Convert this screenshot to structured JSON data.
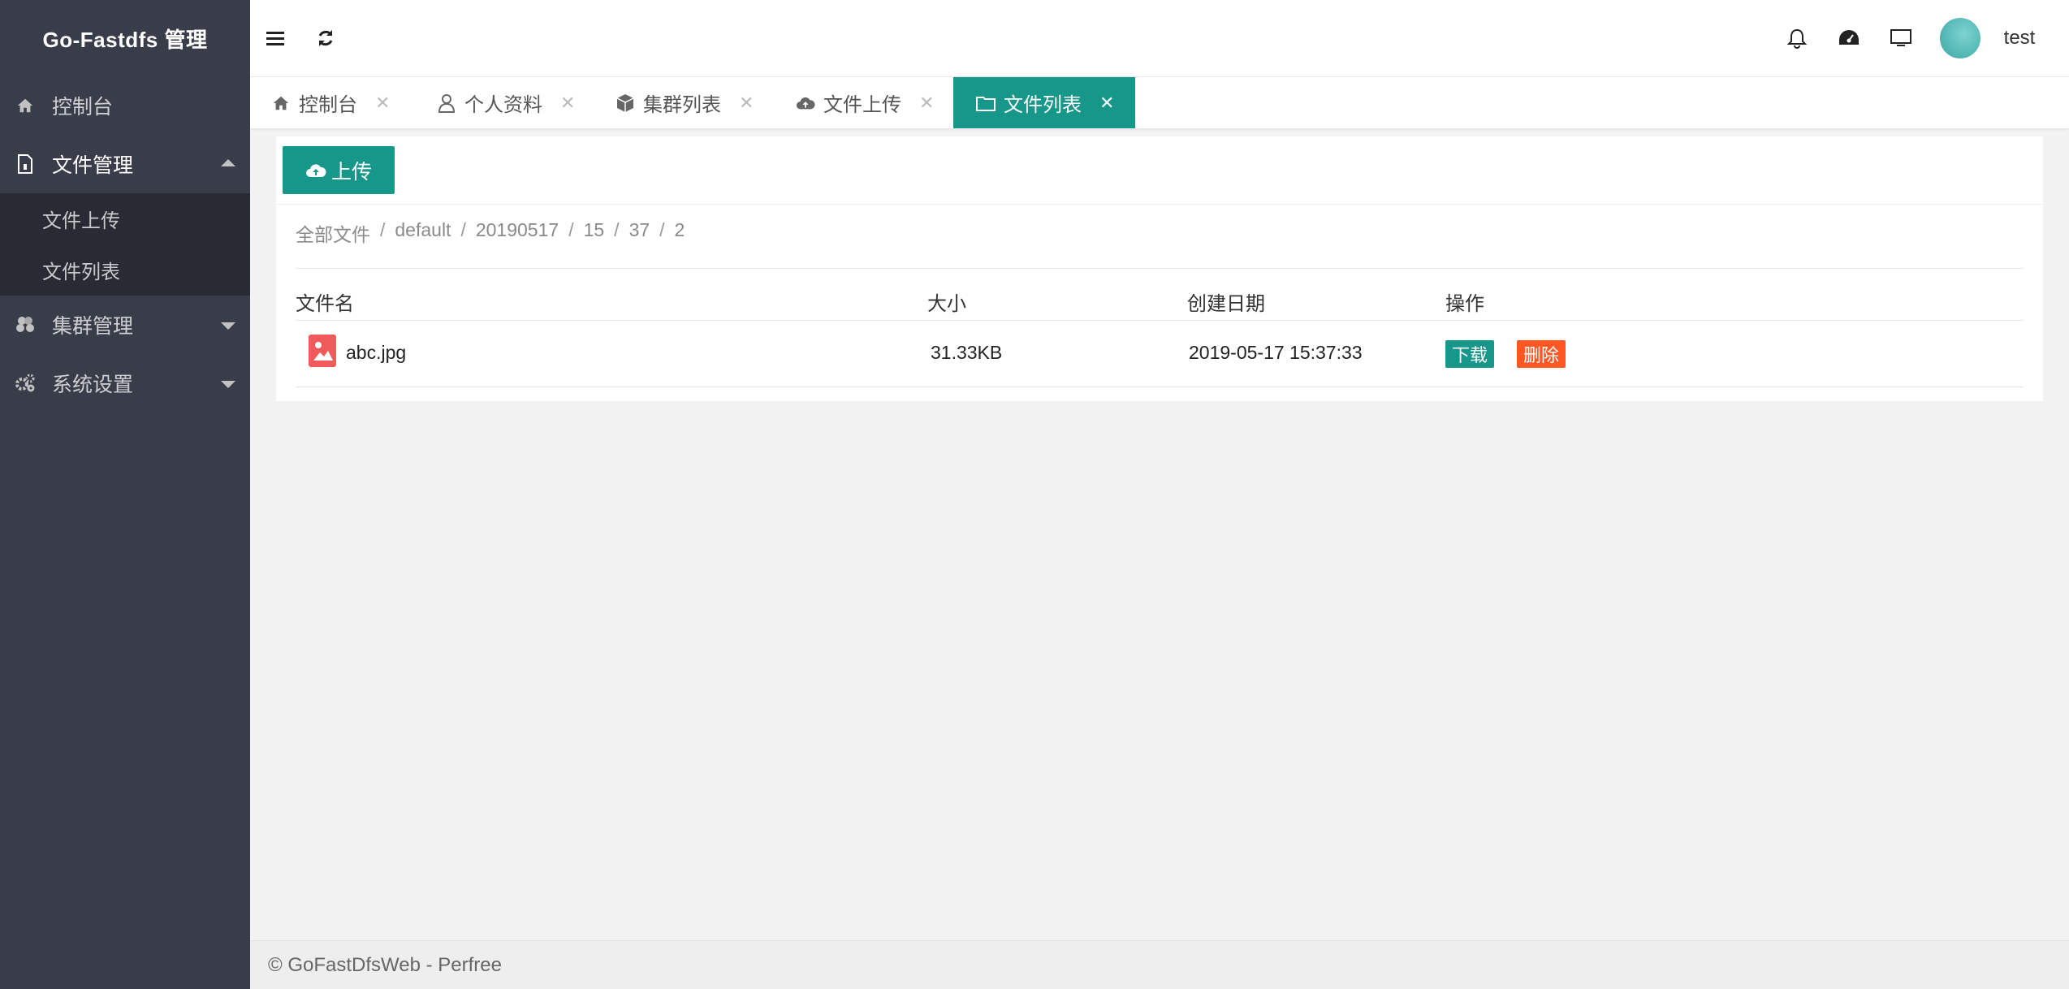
{
  "app": {
    "title": "Go-Fastdfs 管理"
  },
  "sidebar": {
    "items": [
      {
        "label": "控制台",
        "icon": "home-icon"
      },
      {
        "label": "文件管理",
        "icon": "file-icon",
        "expanded": true,
        "children": [
          {
            "label": "文件上传"
          },
          {
            "label": "文件列表"
          }
        ]
      },
      {
        "label": "集群管理",
        "icon": "cubes-icon"
      },
      {
        "label": "系统设置",
        "icon": "gears-icon"
      }
    ]
  },
  "header": {
    "menu_icon": "menu-icon",
    "refresh_icon": "refresh-icon",
    "right_icons": [
      "bell-icon",
      "dashboard-icon",
      "monitor-icon"
    ],
    "user": {
      "name": "test"
    }
  },
  "tabs": [
    {
      "label": "控制台",
      "icon": "home-icon",
      "active": false
    },
    {
      "label": "个人资料",
      "icon": "user-icon",
      "active": false
    },
    {
      "label": "集群列表",
      "icon": "cube-icon",
      "active": false
    },
    {
      "label": "文件上传",
      "icon": "cloud-upload-icon",
      "active": false
    },
    {
      "label": "文件列表",
      "icon": "folder-icon",
      "active": true
    }
  ],
  "content": {
    "upload_button": "上传",
    "breadcrumb": [
      "全部文件",
      "default",
      "20190517",
      "15",
      "37",
      "2"
    ],
    "table": {
      "columns": [
        "文件名",
        "大小",
        "创建日期",
        "操作"
      ],
      "rows": [
        {
          "name": "abc.jpg",
          "size": "31.33KB",
          "date": "2019-05-17 15:37:33",
          "actions": {
            "download": "下载",
            "delete": "删除"
          }
        }
      ]
    }
  },
  "footer": {
    "text": "© GoFastDfsWeb - Perfree"
  },
  "colors": {
    "accent": "#16978a",
    "danger": "#ff5722",
    "sidebar": "#393d49"
  }
}
